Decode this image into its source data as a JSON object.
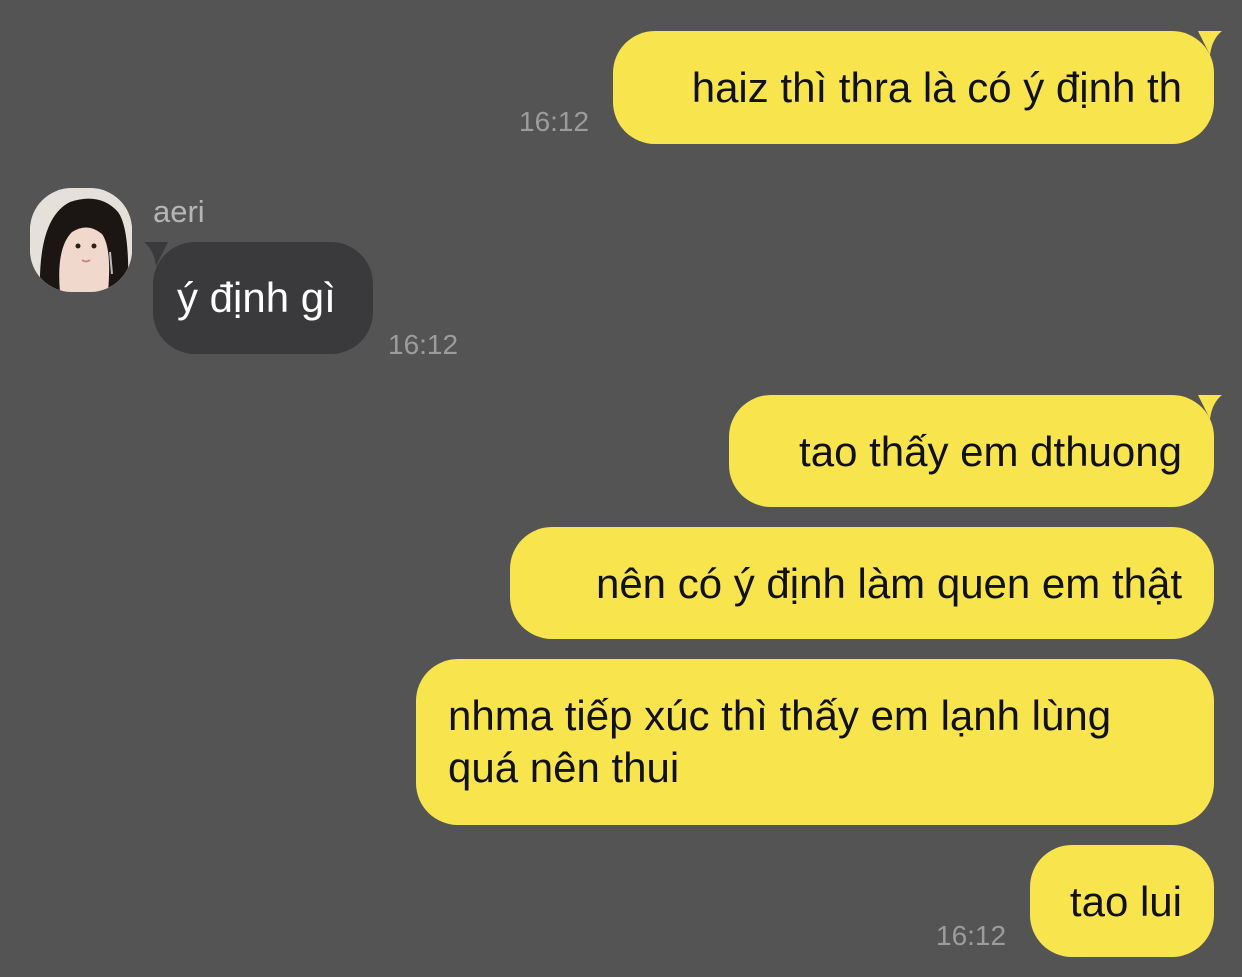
{
  "conversation": {
    "contact": {
      "name": "aeri"
    },
    "messages": [
      {
        "text": "haiz thì thra là có ý định th",
        "time": "16:12"
      },
      {
        "text": "ý định gì",
        "time": "16:12"
      },
      {
        "text": "tao thấy em dthuong"
      },
      {
        "text": "nên có ý định làm quen em thật"
      },
      {
        "text_line1": "nhma tiếp xúc thì thấy em lạnh lùng",
        "text_line2": "quá nên thui"
      },
      {
        "text": "tao lui",
        "time": "16:12"
      }
    ]
  },
  "colors": {
    "background": "#545454",
    "outgoing_bubble": "#F8E44D",
    "incoming_bubble": "#3A3A3C",
    "timestamp": "#9C9C9C"
  }
}
